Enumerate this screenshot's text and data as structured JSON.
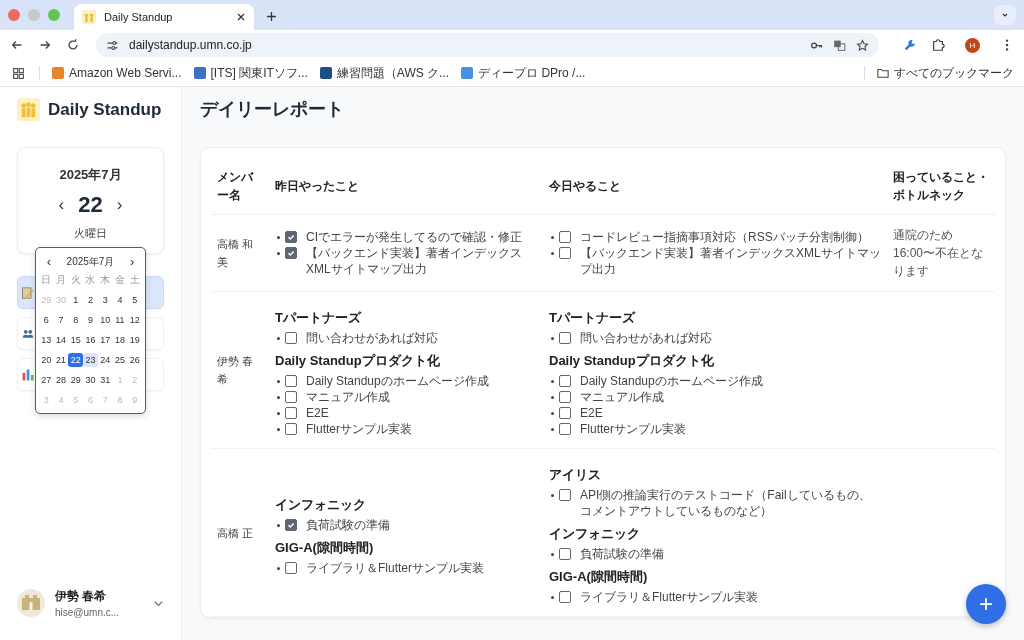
{
  "browser": {
    "tab": {
      "title": "Daily Standup"
    },
    "url": "dailystandup.umn.co.jp",
    "profile": "H",
    "bookmarks": [
      {
        "label": "Amazon Web Servi...",
        "color": "#e8862a"
      },
      {
        "label": "[ITS] 関東ITソフ...",
        "color": "#3d6fc2"
      },
      {
        "label": "練習問題（AWS ク...",
        "color": "#1d4f86"
      },
      {
        "label": "ディープロ DPro /...",
        "color": "#4a90e2"
      }
    ],
    "all_bookmarks": "すべてのブックマーク"
  },
  "sidebar": {
    "app_title": "Daily Standup",
    "date_card": {
      "month": "2025年7月",
      "prev": "‹",
      "day": "22",
      "next": "›",
      "weekday": "火曜日"
    },
    "nav": [
      {
        "kind": "memo",
        "selected": true
      },
      {
        "kind": "people",
        "selected": false
      },
      {
        "kind": "chart",
        "selected": false
      }
    ],
    "calendar": {
      "prev": "‹",
      "month": "2025年7月",
      "next": "›",
      "weekdays": [
        "日",
        "月",
        "火",
        "水",
        "木",
        "金",
        "土"
      ],
      "days": [
        {
          "label": "29",
          "kind": "other",
          "selected": false,
          "highlighted": false
        },
        {
          "label": "30",
          "kind": "other",
          "selected": false,
          "highlighted": false
        },
        {
          "label": "1",
          "kind": "current",
          "selected": false,
          "highlighted": false
        },
        {
          "label": "2",
          "kind": "current",
          "selected": false,
          "highlighted": false
        },
        {
          "label": "3",
          "kind": "current",
          "selected": false,
          "highlighted": false
        },
        {
          "label": "4",
          "kind": "current",
          "selected": false,
          "highlighted": false
        },
        {
          "label": "5",
          "kind": "current",
          "selected": false,
          "highlighted": false
        },
        {
          "label": "6",
          "kind": "current",
          "selected": false,
          "highlighted": false
        },
        {
          "label": "7",
          "kind": "current",
          "selected": false,
          "highlighted": false
        },
        {
          "label": "8",
          "kind": "current",
          "selected": false,
          "highlighted": false
        },
        {
          "label": "9",
          "kind": "current",
          "selected": false,
          "highlighted": false
        },
        {
          "label": "10",
          "kind": "current",
          "selected": false,
          "highlighted": false
        },
        {
          "label": "11",
          "kind": "current",
          "selected": false,
          "highlighted": false
        },
        {
          "label": "12",
          "kind": "current",
          "selected": false,
          "highlighted": false
        },
        {
          "label": "13",
          "kind": "current",
          "selected": false,
          "highlighted": false
        },
        {
          "label": "14",
          "kind": "current",
          "selected": false,
          "highlighted": false
        },
        {
          "label": "15",
          "kind": "current",
          "selected": false,
          "highlighted": false
        },
        {
          "label": "16",
          "kind": "current",
          "selected": false,
          "highlighted": false
        },
        {
          "label": "17",
          "kind": "current",
          "selected": false,
          "highlighted": false
        },
        {
          "label": "18",
          "kind": "current",
          "selected": false,
          "highlighted": false
        },
        {
          "label": "19",
          "kind": "current",
          "selected": false,
          "highlighted": false
        },
        {
          "label": "20",
          "kind": "current",
          "selected": false,
          "highlighted": false
        },
        {
          "label": "21",
          "kind": "current",
          "selected": false,
          "highlighted": false
        },
        {
          "label": "22",
          "kind": "current",
          "selected": true,
          "highlighted": false
        },
        {
          "label": "23",
          "kind": "current",
          "selected": false,
          "highlighted": true
        },
        {
          "label": "24",
          "kind": "current",
          "selected": false,
          "highlighted": false
        },
        {
          "label": "25",
          "kind": "current",
          "selected": false,
          "highlighted": false
        },
        {
          "label": "26",
          "kind": "current",
          "selected": false,
          "highlighted": false
        },
        {
          "label": "27",
          "kind": "current",
          "selected": false,
          "highlighted": false
        },
        {
          "label": "28",
          "kind": "current",
          "selected": false,
          "highlighted": false
        },
        {
          "label": "29",
          "kind": "current",
          "selected": false,
          "highlighted": false
        },
        {
          "label": "30",
          "kind": "current",
          "selected": false,
          "highlighted": false
        },
        {
          "label": "31",
          "kind": "current",
          "selected": false,
          "highlighted": false
        },
        {
          "label": "1",
          "kind": "other",
          "selected": false,
          "highlighted": false
        },
        {
          "label": "2",
          "kind": "other",
          "selected": false,
          "highlighted": false
        },
        {
          "label": "3",
          "kind": "other",
          "selected": false,
          "highlighted": false
        },
        {
          "label": "4",
          "kind": "other",
          "selected": false,
          "highlighted": false
        },
        {
          "label": "5",
          "kind": "other",
          "selected": false,
          "highlighted": false
        },
        {
          "label": "6",
          "kind": "other",
          "selected": false,
          "highlighted": false
        },
        {
          "label": "7",
          "kind": "other",
          "selected": false,
          "highlighted": false
        },
        {
          "label": "8",
          "kind": "other",
          "selected": false,
          "highlighted": false
        },
        {
          "label": "9",
          "kind": "other",
          "selected": false,
          "highlighted": false
        }
      ]
    },
    "user": {
      "name": "伊勢 春希",
      "email": "hise@umn.c..."
    }
  },
  "main": {
    "title": "デイリーレポート",
    "columns": [
      "メンバー名",
      "昨日やったこと",
      "今日やること",
      "困っていること・ボトルネック"
    ],
    "rows": [
      {
        "member": "高橋 和美",
        "yesterday": [
          {
            "tasks": [
              {
                "text": "CIでエラーが発生してるので確認・修正",
                "done": true
              },
              {
                "text": "【バックエンド実装】著者インデックスXMLサイトマップ出力",
                "done": true
              }
            ]
          }
        ],
        "today": [
          {
            "tasks": [
              {
                "text": "コードレビュー指摘事項対応（RSSバッチ分割制御）",
                "done": false
              },
              {
                "text": "【バックエンド実装】著者インデックスXMLサイトマップ出力",
                "done": false
              }
            ]
          }
        ],
        "trouble": "通院のため16:00〜不在となります"
      },
      {
        "member": "伊勢 春希",
        "yesterday": [
          {
            "heading": "Tパートナーズ",
            "tasks": [
              {
                "text": "問い合わせがあれば対応",
                "done": false
              }
            ]
          },
          {
            "heading": "Daily Standupプロダクト化",
            "tasks": [
              {
                "text": "Daily Standupのホームページ作成",
                "done": false
              },
              {
                "text": "マニュアル作成",
                "done": false
              },
              {
                "text": "E2E",
                "done": false
              },
              {
                "text": "Flutterサンプル実装",
                "done": false
              }
            ]
          }
        ],
        "today": [
          {
            "heading": "Tパートナーズ",
            "tasks": [
              {
                "text": "問い合わせがあれば対応",
                "done": false
              }
            ]
          },
          {
            "heading": "Daily Standupプロダクト化",
            "tasks": [
              {
                "text": "Daily Standupのホームページ作成",
                "done": false
              },
              {
                "text": "マニュアル作成",
                "done": false
              },
              {
                "text": "E2E",
                "done": false
              },
              {
                "text": "Flutterサンプル実装",
                "done": false
              }
            ]
          }
        ]
      },
      {
        "member": "高橋 正",
        "yesterday": [
          {
            "heading": "インフォニック",
            "tasks": [
              {
                "text": "負荷試験の準備",
                "done": true
              }
            ]
          },
          {
            "heading": "GIG-A(隙間時間)",
            "tasks": [
              {
                "text": "ライブラリ＆Flutterサンプル実装",
                "done": false
              }
            ]
          }
        ],
        "today": [
          {
            "heading": "アイリス",
            "tasks": [
              {
                "text": "API側の推論実行のテストコード（Failしているもの、コメントアウトしているものなど）",
                "done": false
              }
            ]
          },
          {
            "heading": "インフォニック",
            "tasks": [
              {
                "text": "負荷試験の準備",
                "done": false
              }
            ]
          },
          {
            "heading": "GIG-A(隙間時間)",
            "tasks": [
              {
                "text": "ライブラリ＆Flutterサンプル実装",
                "done": false
              }
            ]
          }
        ]
      }
    ],
    "add_button": "+"
  }
}
